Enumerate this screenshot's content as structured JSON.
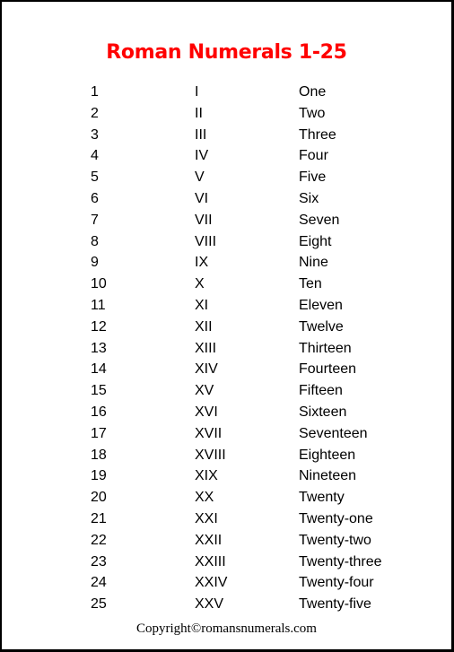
{
  "title": "Roman Numerals 1-25",
  "colors": {
    "title": "#ff0000",
    "text": "#000000",
    "border": "#000000"
  },
  "rows": [
    {
      "number": "1",
      "roman": "I",
      "word": "One"
    },
    {
      "number": "2",
      "roman": "II",
      "word": "Two"
    },
    {
      "number": "3",
      "roman": "III",
      "word": "Three"
    },
    {
      "number": "4",
      "roman": "IV",
      "word": "Four"
    },
    {
      "number": "5",
      "roman": "V",
      "word": "Five"
    },
    {
      "number": "6",
      "roman": "VI",
      "word": "Six"
    },
    {
      "number": "7",
      "roman": "VII",
      "word": "Seven"
    },
    {
      "number": "8",
      "roman": "VIII",
      "word": "Eight"
    },
    {
      "number": "9",
      "roman": "IX",
      "word": "Nine"
    },
    {
      "number": "10",
      "roman": "X",
      "word": "Ten"
    },
    {
      "number": "11",
      "roman": "XI",
      "word": "Eleven"
    },
    {
      "number": "12",
      "roman": "XII",
      "word": "Twelve"
    },
    {
      "number": "13",
      "roman": "XIII",
      "word": "Thirteen"
    },
    {
      "number": "14",
      "roman": "XIV",
      "word": "Fourteen"
    },
    {
      "number": "15",
      "roman": "XV",
      "word": "Fifteen"
    },
    {
      "number": "16",
      "roman": "XVI",
      "word": "Sixteen"
    },
    {
      "number": "17",
      "roman": "XVII",
      "word": "Seventeen"
    },
    {
      "number": "18",
      "roman": "XVIII",
      "word": "Eighteen"
    },
    {
      "number": "19",
      "roman": "XIX",
      "word": "Nineteen"
    },
    {
      "number": "20",
      "roman": "XX",
      "word": "Twenty"
    },
    {
      "number": "21",
      "roman": "XXI",
      "word": "Twenty-one"
    },
    {
      "number": "22",
      "roman": "XXII",
      "word": "Twenty-two"
    },
    {
      "number": "23",
      "roman": "XXIII",
      "word": "Twenty-three"
    },
    {
      "number": "24",
      "roman": "XXIV",
      "word": "Twenty-four"
    },
    {
      "number": "25",
      "roman": "XXV",
      "word": "Twenty-five"
    }
  ],
  "footer": "Copyright©romansnumerals.com"
}
